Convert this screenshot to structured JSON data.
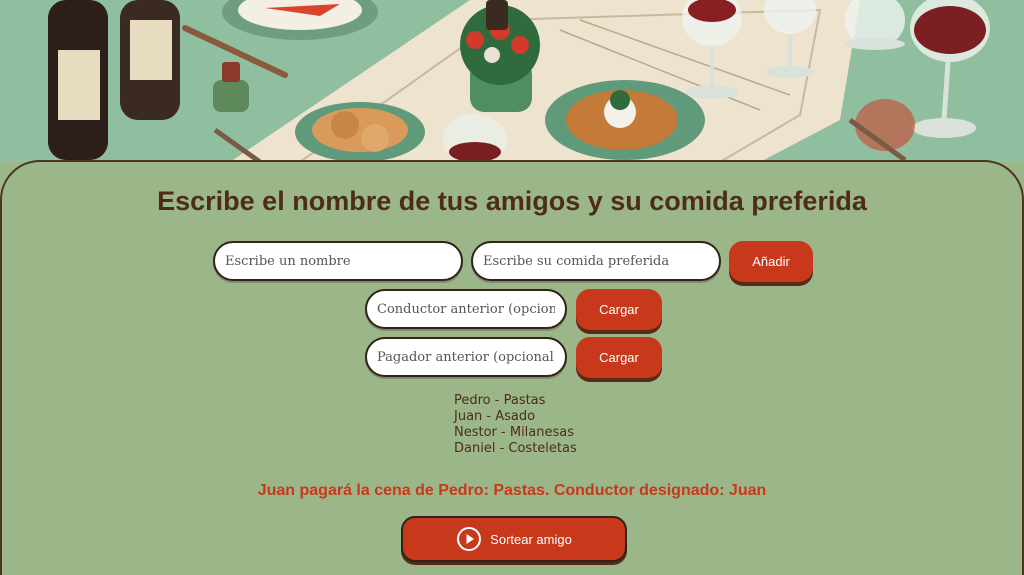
{
  "header": {
    "title": "Escribe el nombre de tus amigos y su comida preferida"
  },
  "form": {
    "name_placeholder": "Escribe un nombre",
    "food_placeholder": "Escribe su comida preferida",
    "add_label": "Añadir",
    "prev_driver_placeholder": "Conductor anterior (opcional)",
    "prev_driver_load_label": "Cargar",
    "prev_payer_placeholder": "Pagador anterior (opcional)",
    "prev_payer_load_label": "Cargar"
  },
  "friends": [
    "Pedro - Pastas",
    "Juan - Asado",
    "Nestor - Milanesas",
    "Daniel - Costeletas"
  ],
  "result": {
    "text": "Juan pagará la cena de Pedro: Pastas. Conductor designado: Juan"
  },
  "draw": {
    "label": "Sortear amigo",
    "icon": "play-circle-icon"
  },
  "colors": {
    "background": "#9bb688",
    "accent": "#c8391c",
    "title": "#4e2c1c",
    "border": "#2f241c"
  }
}
